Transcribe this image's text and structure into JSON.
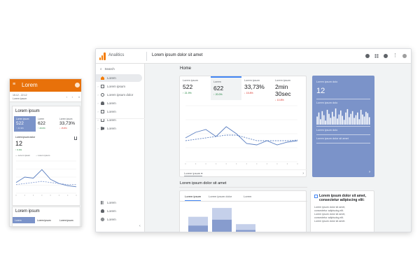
{
  "desktop": {
    "app_name": "Analitics",
    "property": "Lorem ipsum dolor sit amet",
    "header_icons": [
      "bell-icon",
      "apps-grid-icon",
      "help-icon",
      "more-vert-icon"
    ],
    "sidebar": {
      "search": "Search",
      "items": [
        {
          "label": "Lorem",
          "icon": "home-icon",
          "active": true,
          "caret": false
        },
        {
          "label": "Lorem ipsum",
          "icon": "dashboard-icon",
          "caret": true
        },
        {
          "label": "Lorem ipsum dolor",
          "icon": "clock-icon",
          "caret": true
        },
        {
          "label": "Lorem",
          "icon": "person-icon",
          "caret": true
        },
        {
          "label": "Lorem",
          "icon": "share-icon",
          "caret": true
        },
        {
          "label": "Lorem",
          "icon": "display-icon",
          "caret": true
        },
        {
          "label": "Lorem",
          "icon": "flag-icon",
          "caret": true
        }
      ],
      "bottom_items": [
        {
          "label": "Lorem",
          "icon": "bar-icon"
        },
        {
          "label": "Lorem",
          "icon": "bulb-icon"
        },
        {
          "label": "Lorem",
          "icon": "gear-icon"
        }
      ]
    },
    "home_title": "Home",
    "overview": {
      "metrics": [
        {
          "label": "Lorem ipsum",
          "value": "522",
          "delta": "↑ 21.9%",
          "dir": "up"
        },
        {
          "label": "Lorem",
          "value": "622",
          "delta": "↑ 20.0%",
          "dir": "up"
        },
        {
          "label": "Lorem ipsum",
          "value": "33,73%",
          "delta": "↓ 15.8%",
          "dir": "down"
        },
        {
          "label": "Lorem ipsum",
          "value": "2min 30sec",
          "delta": "↓ 10.8%",
          "dir": "down"
        }
      ],
      "selected_metric": 1,
      "dropdown": "Lorem ipsum"
    },
    "realtime": {
      "label1": "Lorem ipsum dolo",
      "value": "12",
      "label2": "Lorem ipsum dolo",
      "label3": "Lorem ipsum dolo",
      "label4": "Lorem ipsum dolor sit amet"
    },
    "section2": {
      "title": "Lorem ipsum dolor sit amet",
      "tabs": [
        "Lorem ipsum",
        "Lorem ipsum dolor",
        "Lorem"
      ],
      "active_tab": 0
    },
    "insight": {
      "title": "Lorem ipsum dolor sit amet, consectetur adipiscing elit:",
      "body": [
        "Lorem ipsum dolor sit amet,",
        "consectetur adipiscing elit.",
        "Lorem ipsum dolor sit amet,",
        "consectetur adipiscing elit.",
        "Lorem ipsum dolor sit amet."
      ]
    }
  },
  "mobile": {
    "title": "Lorem",
    "sub1": "15.12 - 22.12",
    "sub2": "Lorem ipsum",
    "card1_title": "Lorem ipsum",
    "metrics": [
      {
        "label": "Lorem ipsum",
        "value": "522",
        "delta": "↑ 21.9%"
      },
      {
        "label": "Lorem",
        "value": "622",
        "delta": "↑ 20.0%"
      },
      {
        "label": "Lorem ipsum",
        "value": "33,73%",
        "delta": "↓ 15.8%"
      }
    ],
    "realtime_label": "Lorem ipsum dolor",
    "realtime_value": "12",
    "realtime_delta": "↑ 6.0%",
    "legend": [
      "Lorem ipsum",
      "Lorem ipsum"
    ],
    "card2_title": "Lorem ipsum",
    "tabs": [
      "Lorem",
      "Lorem ipsum",
      "Lorem ipsum"
    ]
  },
  "chart_data": [
    {
      "type": "line",
      "x": [
        1,
        2,
        3,
        4,
        5,
        6,
        7,
        8,
        9,
        10,
        11,
        12
      ],
      "series": [
        {
          "values": [
            34,
            42,
            46,
            36,
            50,
            40,
            26,
            24,
            30,
            24,
            28,
            30
          ]
        },
        {
          "values": [
            30,
            32,
            34,
            36,
            38,
            38,
            34,
            30,
            30,
            30,
            30,
            31
          ]
        }
      ],
      "ylim": [
        0,
        80
      ]
    },
    {
      "type": "bar",
      "values": [
        12,
        18,
        8,
        20,
        14,
        6,
        22,
        16,
        10,
        19,
        12,
        24,
        9,
        15,
        21,
        13,
        7,
        18,
        23,
        11,
        16,
        20,
        10,
        14,
        18,
        8,
        22,
        15,
        12,
        19,
        17,
        11
      ],
      "ylim": [
        0,
        25
      ]
    },
    {
      "type": "bar",
      "categories": [
        "Lorem ipsum",
        "Lorem ipsum dolor",
        "Lorem"
      ],
      "series": [
        {
          "values": [
            26,
            38,
            16
          ]
        },
        {
          "values": [
            14,
            22,
            8
          ]
        }
      ],
      "ylim": [
        0,
        40
      ]
    },
    {
      "type": "line",
      "x": [
        1,
        2,
        3,
        4,
        5,
        6,
        7,
        8
      ],
      "series": [
        {
          "values": [
            20,
            30,
            28,
            44,
            26,
            18,
            14,
            12
          ]
        },
        {
          "values": [
            16,
            18,
            20,
            22,
            20,
            18,
            16,
            16
          ]
        }
      ],
      "ylim": [
        0,
        60
      ]
    }
  ]
}
